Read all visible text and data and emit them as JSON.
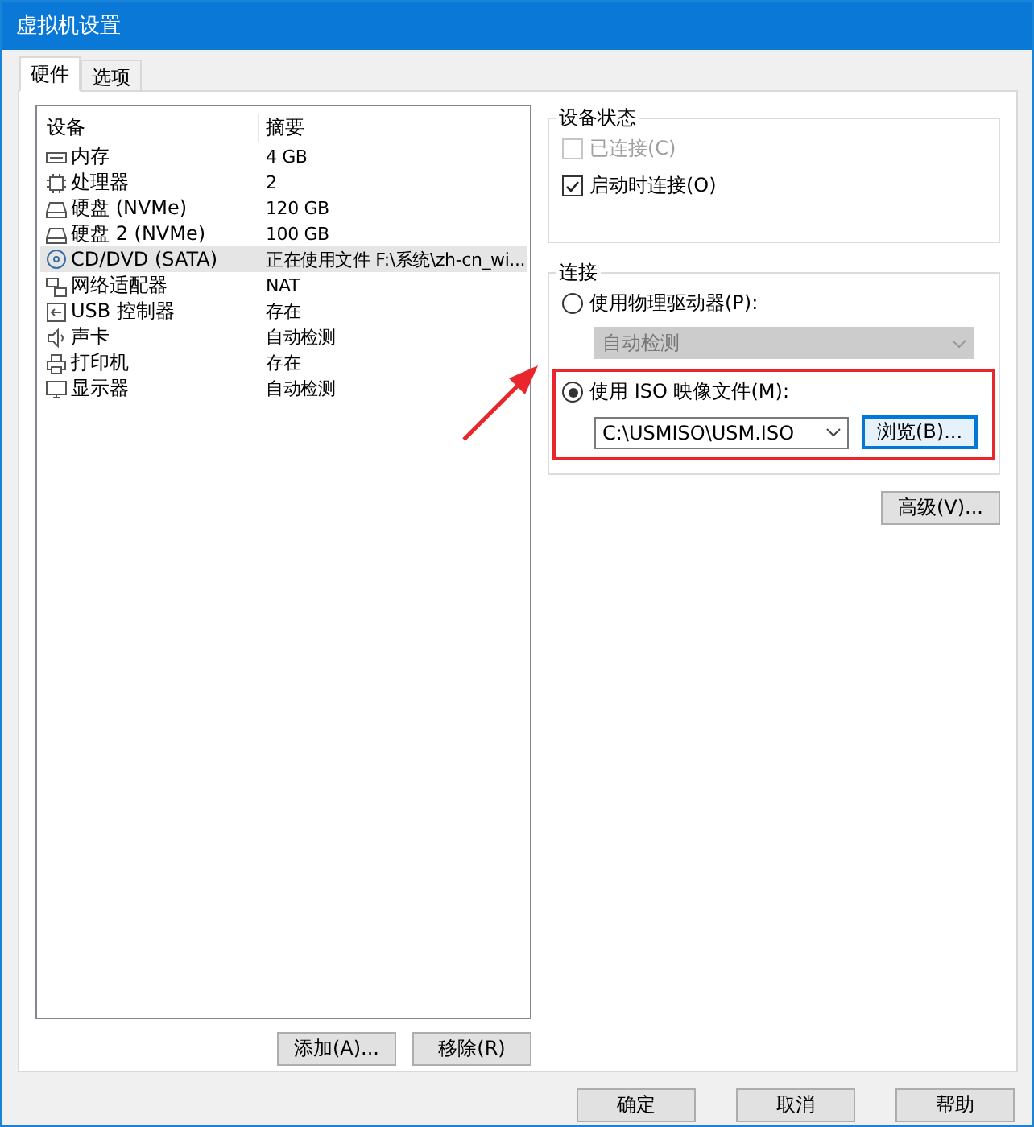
{
  "window": {
    "title": "虚拟机设置"
  },
  "tabs": [
    {
      "label": "硬件",
      "selected": true
    },
    {
      "label": "选项",
      "selected": false
    }
  ],
  "device_table": {
    "columns": [
      "设备",
      "摘要"
    ],
    "rows": [
      {
        "kind": "memory",
        "device": "内存",
        "summary": "4 GB",
        "selected": false
      },
      {
        "kind": "cpu",
        "device": "处理器",
        "summary": "2",
        "selected": false
      },
      {
        "kind": "disk",
        "device": "硬盘 (NVMe)",
        "summary": "120 GB",
        "selected": false
      },
      {
        "kind": "disk",
        "device": "硬盘 2 (NVMe)",
        "summary": "100 GB",
        "selected": false
      },
      {
        "kind": "cd",
        "device": "CD/DVD (SATA)",
        "summary": "正在使用文件 F:\\系统\\zh-cn_wi...",
        "selected": true
      },
      {
        "kind": "network",
        "device": "网络适配器",
        "summary": "NAT",
        "selected": false
      },
      {
        "kind": "usb",
        "device": "USB 控制器",
        "summary": "存在",
        "selected": false
      },
      {
        "kind": "sound",
        "device": "声卡",
        "summary": "自动检测",
        "selected": false
      },
      {
        "kind": "printer",
        "device": "打印机",
        "summary": "存在",
        "selected": false
      },
      {
        "kind": "display",
        "device": "显示器",
        "summary": "自动检测",
        "selected": false
      }
    ]
  },
  "list_buttons": [
    "添加(A)...",
    "移除(R)"
  ],
  "device_status": {
    "title": "设备状态",
    "options": [
      {
        "label": "已连接(C)",
        "checked": false,
        "disabled": true
      },
      {
        "label": "启动时连接(O)",
        "checked": true,
        "disabled": false
      }
    ]
  },
  "connection": {
    "title": "连接",
    "physical": {
      "label": "使用物理驱动器(P):",
      "selected": false,
      "drive": "自动检测"
    },
    "iso": {
      "label": "使用 ISO 映像文件(M):",
      "selected": true,
      "path": "C:\\USMISO\\USM.ISO",
      "browse": "浏览(B)..."
    }
  },
  "advanced_button": "高级(V)...",
  "dialog_buttons": [
    "确定",
    "取消",
    "帮助"
  ]
}
